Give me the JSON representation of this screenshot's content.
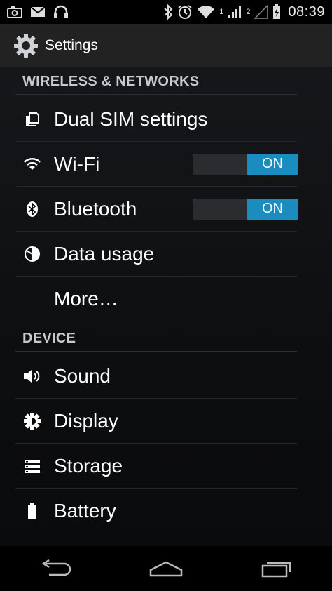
{
  "status_bar": {
    "time": "08:39",
    "sim1": "1",
    "sim2": "2",
    "icons_left": [
      "camera-icon",
      "mail-icon",
      "headphones-icon"
    ],
    "icons_right": [
      "bluetooth-icon",
      "alarm-icon",
      "wifi-icon",
      "signal-icon",
      "signal-icon",
      "battery-icon"
    ]
  },
  "action_bar": {
    "title": "Settings",
    "icon": "settings-gear-icon"
  },
  "sections": {
    "wireless": {
      "header": "WIRELESS & NETWORKS",
      "items": {
        "dual_sim": {
          "label": "Dual SIM settings",
          "icon": "sim-card-icon"
        },
        "wifi": {
          "label": "Wi-Fi",
          "icon": "wifi-icon",
          "toggle": "ON"
        },
        "bluetooth": {
          "label": "Bluetooth",
          "icon": "bluetooth-icon",
          "toggle": "ON"
        },
        "data_usage": {
          "label": "Data usage",
          "icon": "data-usage-icon"
        },
        "more": {
          "label": "More…"
        }
      }
    },
    "device": {
      "header": "DEVICE",
      "items": {
        "sound": {
          "label": "Sound",
          "icon": "speaker-icon"
        },
        "display": {
          "label": "Display",
          "icon": "brightness-icon"
        },
        "storage": {
          "label": "Storage",
          "icon": "storage-icon"
        },
        "battery": {
          "label": "Battery",
          "icon": "battery-icon"
        }
      }
    }
  },
  "nav_bar": {
    "buttons": [
      "back-icon",
      "home-icon",
      "recents-icon"
    ]
  },
  "colors": {
    "accent": "#1a8cbf",
    "action_bar_bg": "#222222",
    "status_bar_bg": "#000000"
  }
}
